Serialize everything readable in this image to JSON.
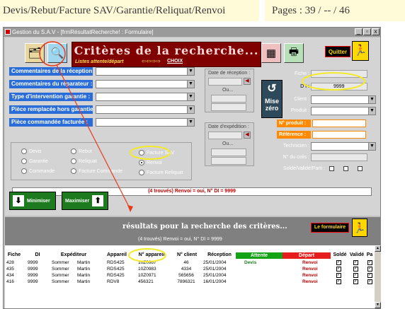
{
  "header": {
    "left_title": "Devis/Rebut/Facture SAV/Garantie/Reliquat/Renvoi",
    "pages": "Pages : 39 / -- / 46"
  },
  "window": {
    "title": "Gestion du S.A.V - [frmRésultatRecherche! : Formulaire]",
    "min_label": "_",
    "max_label": "▫",
    "close_label": "x"
  },
  "banner": {
    "title": "Critères de la recherche...",
    "subtitle": "Listes attente/départ",
    "choix": "CHOIX"
  },
  "buttons": {
    "quitter": "Quitter",
    "mise_zero": "Mise zéro",
    "minimiser": "Minimiser",
    "maximiser": "Maximiser",
    "le_formulaire": "Le formulaire"
  },
  "criteria": [
    {
      "label": "Commentaires de la réception :"
    },
    {
      "label": "Commentaires du réparateur :"
    },
    {
      "label": "Type d'intervention garantie :"
    },
    {
      "label": "Pièce remplacée hors garantie :"
    },
    {
      "label": "Pièce commandée facturée :"
    }
  ],
  "dates": {
    "reception_label": "Date de réception :",
    "reception_ou": "Ou...",
    "expedition_label": "Date d'expédition :",
    "expedition_ou": "Ou..."
  },
  "right_form": {
    "fiche": "Fiche :",
    "di": "D I :",
    "di_value": "9999",
    "client": "Client :",
    "produit": "Produit :",
    "n_produit": "N° produit :",
    "reference": "Référence :",
    "technicien": "Technicien :",
    "n_colis": "N° du colis :",
    "solde_valide_parti": "Soldé/Validé/Parti :"
  },
  "radios": {
    "devis": "Devis",
    "garantie": "Garantie",
    "commande": "Commande",
    "rebut": "Rebut",
    "reliquat": "Reliquat",
    "facture_commande": "Facture Commande",
    "facture_sav": "Facture SAV",
    "renvoi": "Renvoi",
    "facture_reliquat": "Facture Reliquat",
    "selected": "renvoi"
  },
  "found_top": "(4 trouvés)  Renvoi = oui, N° DI = 9999",
  "results": {
    "title": "résultats pour la recherche des critères...",
    "subtitle": "(4 trouvés)  Renvoi = oui, N° DI = 9999"
  },
  "table": {
    "headers": [
      "Fiche",
      "DI",
      "Expéditeur",
      "Appareil",
      "N° appareil",
      "N° client",
      "Réception",
      "Attente",
      "Départ",
      "Soldé",
      "Validé",
      "Pa"
    ],
    "rows": [
      {
        "fiche": "428",
        "di": "9999",
        "exp1": "Sommer",
        "exp2": "Martin",
        "appareil": "RDS425",
        "n_app": "10Z0967",
        "n_client": "46",
        "reception": "25/01/2004",
        "attente": "Devis",
        "depart": "Renvoi"
      },
      {
        "fiche": "435",
        "di": "9999",
        "exp1": "Sommer",
        "exp2": "Martin",
        "appareil": "RDS425",
        "n_app": "10Z0983",
        "n_client": "4334",
        "reception": "25/01/2004",
        "attente": "",
        "depart": "Renvoi"
      },
      {
        "fiche": "434",
        "di": "9999",
        "exp1": "Sommer",
        "exp2": "Martin",
        "appareil": "RDS425",
        "n_app": "10Z0971",
        "n_client": "565656",
        "reception": "25/01/2004",
        "attente": "",
        "depart": "Renvoi"
      },
      {
        "fiche": "416",
        "di": "9999",
        "exp1": "Sommer",
        "exp2": "Martin",
        "appareil": "RDV8",
        "n_app": "456321",
        "n_client": "7896321",
        "reception": "16/01/2004",
        "attente": "",
        "depart": "Renvoi"
      }
    ]
  },
  "colors": {
    "accent_blue": "#2a6dd9",
    "banner": "#800000",
    "attente_green": "#14a314",
    "depart_red": "#e61e1e",
    "annotation_yellow": "#f2ea2a",
    "annotation_red": "#e83a1a"
  }
}
